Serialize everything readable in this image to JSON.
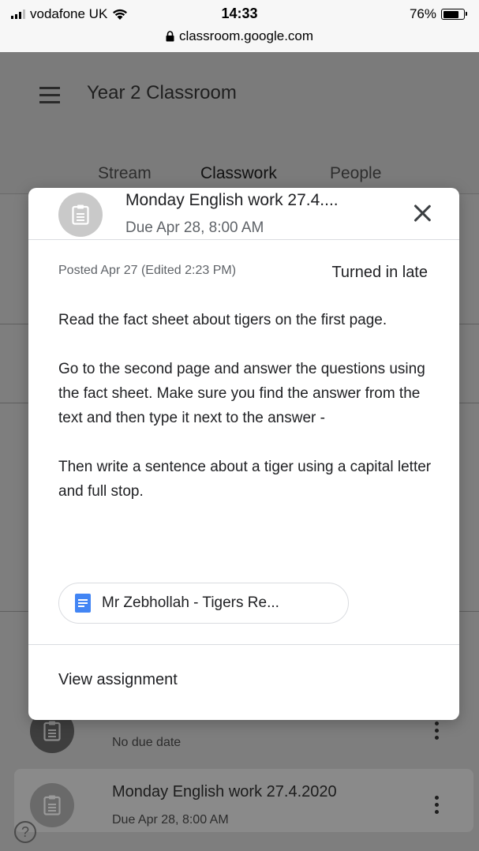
{
  "status_bar": {
    "carrier": "vodafone UK",
    "time": "14:33",
    "battery": "76%",
    "battery_level": 0.76,
    "url": "classroom.google.com"
  },
  "app": {
    "title": "Year 2 Classroom",
    "tabs": [
      {
        "label": "Stream"
      },
      {
        "label": "Classwork"
      },
      {
        "label": "People"
      }
    ],
    "list": [
      {
        "title": "",
        "subtitle": "No due date"
      },
      {
        "title": "Monday English work 27.4.2020",
        "subtitle": "Due Apr 28, 8:00 AM"
      }
    ],
    "help_label": "?"
  },
  "modal": {
    "title": "Monday English work 27.4....",
    "due": "Due Apr 28, 8:00 AM",
    "posted": "Posted Apr 27 (Edited 2:23 PM)",
    "status": "Turned in late",
    "paragraphs": [
      "Read the fact sheet about tigers on the first page.",
      "Go to the second page and answer the questions using the fact sheet. Make sure you find the answer from the text and then type it next to the answer -",
      "Then write a sentence about a tiger using a capital letter and full stop."
    ],
    "attachment": "Mr Zebhollah - Tigers Re...",
    "view_label": "View assignment"
  },
  "colors": {
    "doc_blue": "#4285f4",
    "overlay": "#7e7e7e"
  }
}
